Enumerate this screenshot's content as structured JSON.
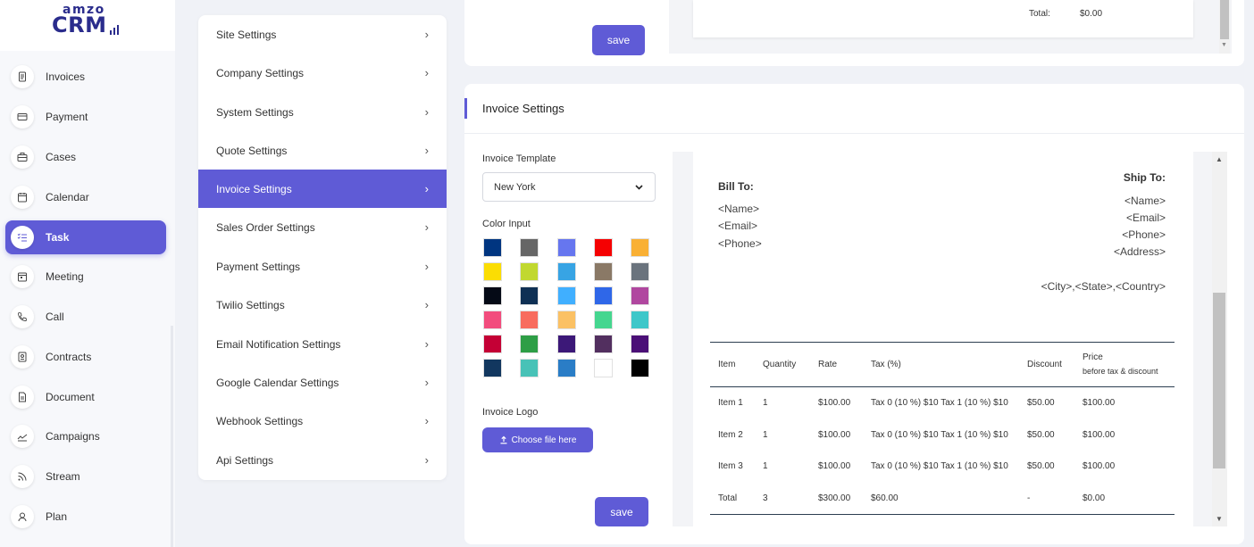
{
  "logo": {
    "top_text": "amzo",
    "main_text": "CRM"
  },
  "sidebar": {
    "items": [
      {
        "label": "Invoices",
        "icon": "invoice-icon"
      },
      {
        "label": "Payment",
        "icon": "card-icon"
      },
      {
        "label": "Cases",
        "icon": "briefcase-icon"
      },
      {
        "label": "Calendar",
        "icon": "calendar-icon"
      },
      {
        "label": "Task",
        "icon": "task-list-icon",
        "active": true
      },
      {
        "label": "Meeting",
        "icon": "meeting-calendar-icon"
      },
      {
        "label": "Call",
        "icon": "phone-icon"
      },
      {
        "label": "Contracts",
        "icon": "contract-icon"
      },
      {
        "label": "Document",
        "icon": "document-icon"
      },
      {
        "label": "Campaigns",
        "icon": "chart-line-icon"
      },
      {
        "label": "Stream",
        "icon": "rss-icon"
      },
      {
        "label": "Plan",
        "icon": "plan-icon"
      }
    ]
  },
  "settings_menu": {
    "items": [
      {
        "label": "Site Settings"
      },
      {
        "label": "Company Settings"
      },
      {
        "label": "System Settings"
      },
      {
        "label": "Quote Settings"
      },
      {
        "label": "Invoice Settings",
        "active": true
      },
      {
        "label": "Sales Order Settings"
      },
      {
        "label": "Payment Settings"
      },
      {
        "label": "Twilio Settings"
      },
      {
        "label": "Email Notification Settings"
      },
      {
        "label": "Google Calendar Settings"
      },
      {
        "label": "Webhook Settings"
      },
      {
        "label": "Api Settings"
      }
    ],
    "chevron": "›"
  },
  "top_card": {
    "save_label": "save",
    "total_label": "Total:",
    "total_value": "$0.00"
  },
  "invoice_settings": {
    "title": "Invoice Settings",
    "template_label": "Invoice Template",
    "template_value": "New York",
    "color_label": "Color Input",
    "colors": [
      "#003580",
      "#666666",
      "#6676ef",
      "#f50102",
      "#f9b034",
      "#fbdd03",
      "#c1d82f",
      "#37a4e4",
      "#8a7966",
      "#6a737d",
      "#050a16",
      "#0f3054",
      "#40afff",
      "#2f67e8",
      "#b0479f",
      "#f24c7d",
      "#f86c5e",
      "#fbc164",
      "#45d68f",
      "#3ec7c9",
      "#c40035",
      "#2e9e46",
      "#3c1878",
      "#522f5f",
      "#4b1077",
      "#12375f",
      "#48c2b7",
      "#2a7dc6",
      "#ffffff",
      "#000000"
    ],
    "logo_label": "Invoice Logo",
    "file_button": "Choose file here",
    "save_label": "save"
  },
  "preview": {
    "bill_to": "Bill To:",
    "bill_name": "<Name>",
    "bill_email": "<Email>",
    "bill_phone": "<Phone>",
    "ship_to": "Ship To:",
    "ship_name": "<Name>",
    "ship_email": "<Email>",
    "ship_phone": "<Phone>",
    "ship_address": "<Address>",
    "ship_city": "<City>,<State>,<Country>",
    "headers": {
      "item": "Item",
      "quantity": "Quantity",
      "rate": "Rate",
      "tax": "Tax (%)",
      "discount": "Discount",
      "price": "Price",
      "price_sub": "before tax & discount"
    },
    "rows": [
      {
        "item": "Item 1",
        "qty": "1",
        "rate": "$100.00",
        "tax": "Tax 0 (10 %) $10 Tax 1 (10 %) $10",
        "discount": "$50.00",
        "price": "$100.00"
      },
      {
        "item": "Item 2",
        "qty": "1",
        "rate": "$100.00",
        "tax": "Tax 0 (10 %) $10 Tax 1 (10 %) $10",
        "discount": "$50.00",
        "price": "$100.00"
      },
      {
        "item": "Item 3",
        "qty": "1",
        "rate": "$100.00",
        "tax": "Tax 0 (10 %) $10 Tax 1 (10 %) $10",
        "discount": "$50.00",
        "price": "$100.00"
      }
    ],
    "total_row": {
      "item": "Total",
      "qty": "3",
      "rate": "$300.00",
      "tax": "$60.00",
      "discount": "-",
      "price": "$0.00"
    }
  }
}
